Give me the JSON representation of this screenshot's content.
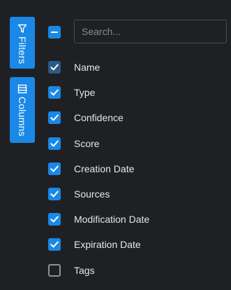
{
  "side_tabs": {
    "filters": {
      "label": "Filters",
      "icon": "filter-icon"
    },
    "columns": {
      "label": "Columns",
      "icon": "columns-icon"
    }
  },
  "header": {
    "select_all_state": "indeterminate",
    "search_placeholder": "Search...",
    "search_value": ""
  },
  "columns": [
    {
      "label": "Name",
      "checked": true,
      "dim": true
    },
    {
      "label": "Type",
      "checked": true
    },
    {
      "label": "Confidence",
      "checked": true
    },
    {
      "label": "Score",
      "checked": true
    },
    {
      "label": "Creation Date",
      "checked": true
    },
    {
      "label": "Sources",
      "checked": true
    },
    {
      "label": "Modification Date",
      "checked": true
    },
    {
      "label": "Expiration Date",
      "checked": true
    },
    {
      "label": "Tags",
      "checked": false
    }
  ],
  "colors": {
    "background": "#1f2023",
    "accent": "#1a88e6",
    "accent_dim": "#2c5a86",
    "text": "#e6e6e6",
    "unchecked_border": "#8f9094"
  }
}
